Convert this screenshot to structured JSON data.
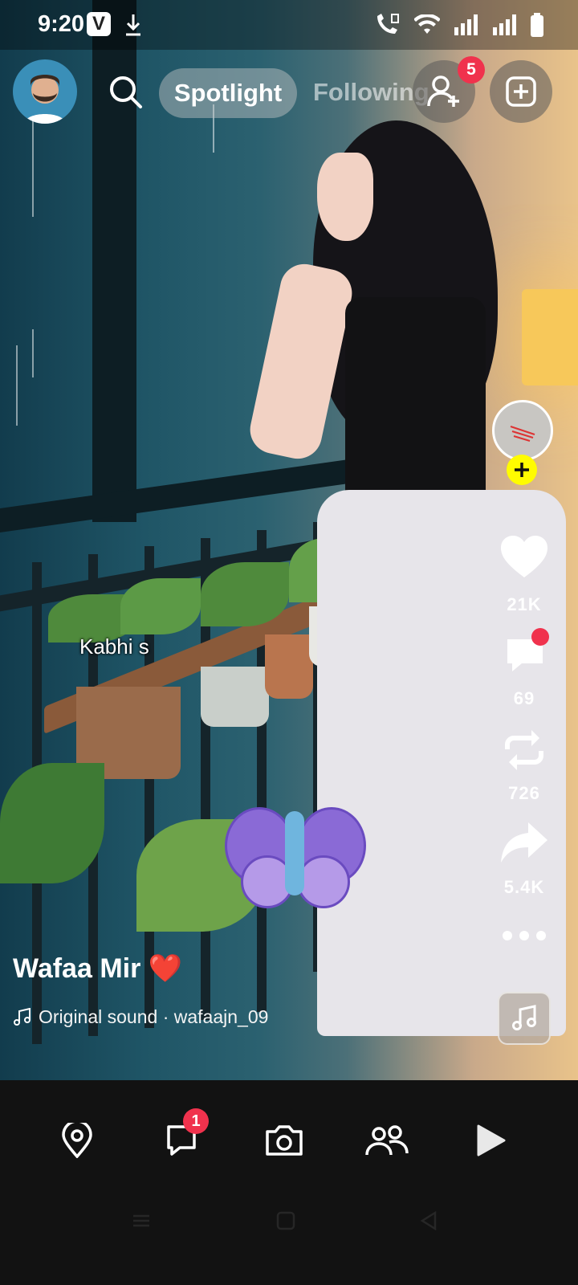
{
  "status_bar": {
    "time": "9:20",
    "icons": [
      "v-app-icon",
      "download-icon",
      "wifi-calling-icon",
      "wifi-icon",
      "signal-icon",
      "signal-icon",
      "battery-icon"
    ]
  },
  "top_bar": {
    "tabs": [
      {
        "label": "Spotlight",
        "active": true
      },
      {
        "label": "Following",
        "active": false
      }
    ],
    "add_friend_badge": "5"
  },
  "video": {
    "overlay_text": "Kabhi s"
  },
  "actions": {
    "likes": "21K",
    "comments": "69",
    "remixes": "726",
    "shares": "5.4K"
  },
  "caption": {
    "creator": "Wafaa Mir",
    "creator_emoji": "❤️",
    "sound": "Original sound · wafaajn_09"
  },
  "bottom_nav": {
    "items": [
      "map-icon",
      "chat-icon",
      "camera-icon",
      "friends-icon",
      "play-icon"
    ],
    "chat_badge": "1"
  },
  "colors": {
    "badge": "#f0324d",
    "accent_yellow": "#fffc00"
  }
}
